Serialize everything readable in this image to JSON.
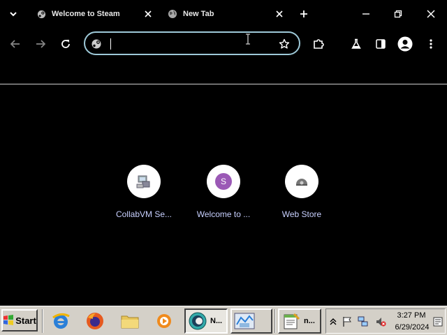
{
  "tabs": [
    {
      "title": "Welcome to Steam",
      "icon": "steam-icon"
    },
    {
      "title": "New Tab",
      "icon": "globe-icon"
    }
  ],
  "omnibox": {
    "value": "",
    "placeholder": ""
  },
  "shortcuts": [
    {
      "label": "CollabVM Se...",
      "icon": "computer-icon"
    },
    {
      "label": "Welcome to ...",
      "icon_letter": "S",
      "icon_color": "#9b59b6"
    },
    {
      "label": "Web Store",
      "icon": "webstore-icon"
    }
  ],
  "taskbar": {
    "start_label": "Start",
    "buttons": [
      {
        "label": "N...",
        "icon": "chrome-icon",
        "active": true
      },
      {
        "label": "",
        "icon": "network-map-icon",
        "active": false
      },
      {
        "label": "n...",
        "icon": "notepad-icon",
        "active": false
      }
    ],
    "clock": {
      "time": "3:27 PM",
      "date": "6/29/2024"
    }
  },
  "colors": {
    "background": "#000000",
    "omnibox_border": "#9ec9d8",
    "shortcut_label": "#c8d0ff",
    "taskbar": "#d4d0c8"
  }
}
